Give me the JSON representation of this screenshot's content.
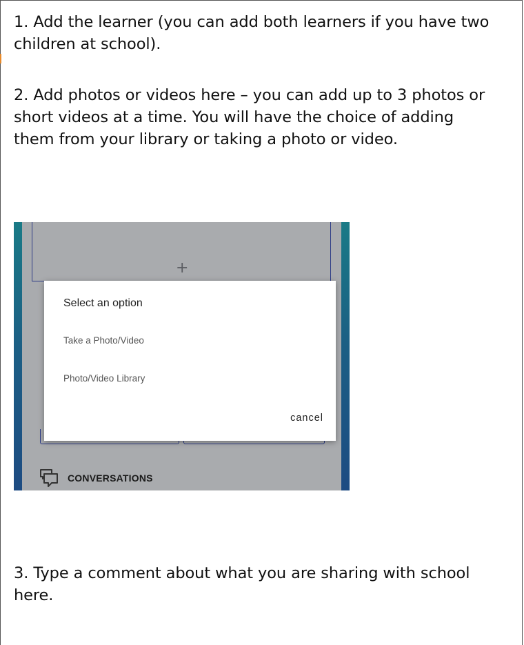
{
  "instructions": {
    "step1": "1. Add the learner (you can add both learners if you have two children at school).",
    "step2": "2. Add photos or videos here – you can add up to 3 photos or short videos at a time. You will have the choice of adding them from your library or taking a photo or video.",
    "step3": "3. Type a comment about what you are sharing with school here."
  },
  "screenshot": {
    "add_media_icon": "+",
    "dialog": {
      "title": "Select an option",
      "options": [
        "Take a Photo/Video",
        "Photo/Video Library"
      ],
      "cancel_label": "cancel"
    },
    "nav": {
      "conversations_label": "CONVERSATIONS",
      "conversations_icon": "chat-bubbles-icon"
    }
  },
  "colors": {
    "phone_edge_top": "#1a7a86",
    "phone_edge_bottom": "#1d4b82",
    "overlay": "#a9abae",
    "outline": "#2c3b86",
    "dialog_bg": "#ffffff"
  }
}
